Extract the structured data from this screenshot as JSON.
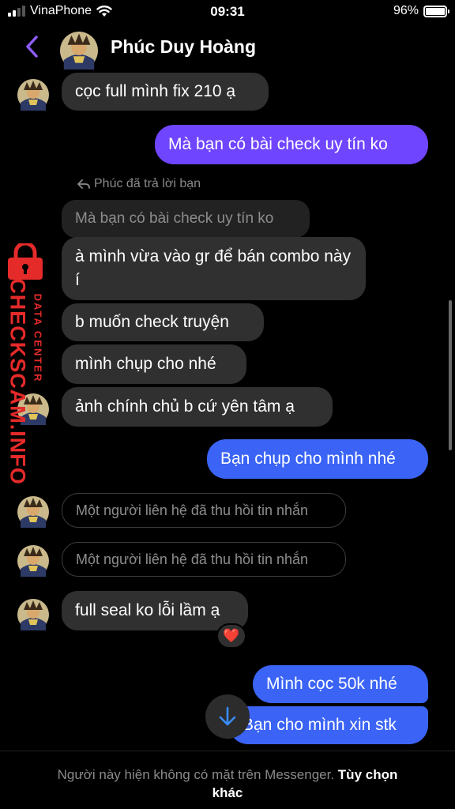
{
  "status_bar": {
    "carrier": "VinaPhone",
    "time": "09:31",
    "battery": "96%",
    "battery_level": 0.96
  },
  "header": {
    "contact_name": "Phúc Duy Hoàng",
    "back_icon": "chevron-left-icon",
    "accent_color": "#8f5cff"
  },
  "messages": [
    {
      "direction": "in",
      "text": "cọc full mình fix 210 ạ"
    },
    {
      "direction": "out",
      "text": "Mà bạn có bài check uy tín ko"
    },
    {
      "direction": "in",
      "reply_note": "Phúc đã trả lời bạn",
      "quoted_text": "Mà bạn có bài check uy tín ko",
      "text": "à mình vừa vào gr để bán combo này í"
    },
    {
      "direction": "in",
      "text": "b muốn check truyện"
    },
    {
      "direction": "in",
      "text": "mình chụp cho nhé"
    },
    {
      "direction": "in",
      "text": "ảnh chính chủ b cứ yên tâm ạ"
    },
    {
      "direction": "out",
      "text": "Bạn chụp cho mình nhé"
    },
    {
      "direction": "in",
      "recalled": true,
      "text": "Một người liên hệ đã thu hồi tin nhắn"
    },
    {
      "direction": "in",
      "recalled": true,
      "text": "Một người liên hệ đã thu hồi tin nhắn"
    },
    {
      "direction": "in",
      "text": "full seal ko lỗi lầm ạ",
      "reaction": "❤️"
    },
    {
      "direction": "out",
      "text": "Mình cọc 50k nhé"
    },
    {
      "direction": "out",
      "text": "Bạn cho mình xin stk"
    }
  ],
  "footer": {
    "notice": "Người này hiện không có mặt trên Messenger.",
    "more_options": "Tùy chọn khác"
  },
  "watermark": {
    "main": "CHECKSCAM.INFO",
    "sub": "DATA CENTER",
    "icon": "lock-icon"
  },
  "colors": {
    "incoming_bubble": "#303030",
    "outgoing_purple": "#6f45ff",
    "outgoing_blue": "#3b64f6",
    "watermark_red": "#e52a2a"
  }
}
